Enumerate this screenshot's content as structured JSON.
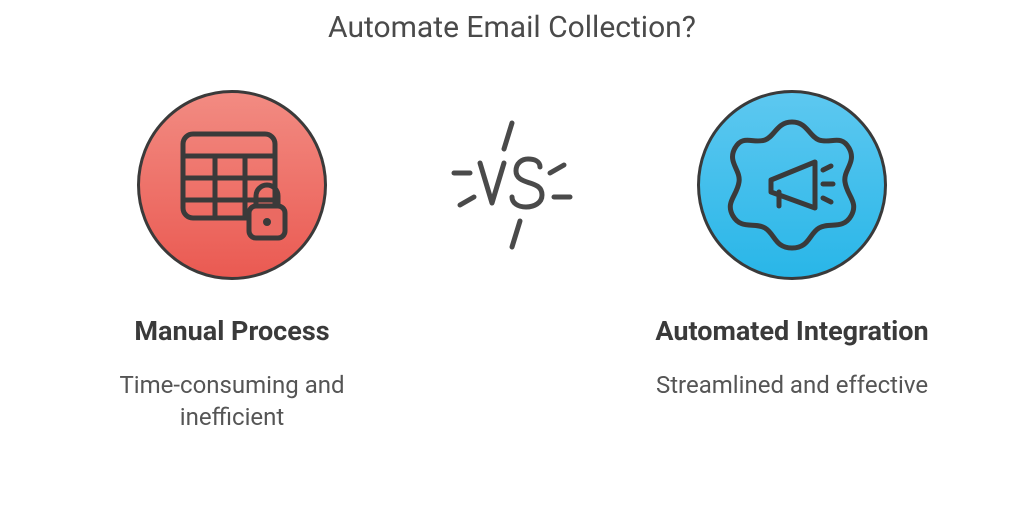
{
  "title": "Automate Email Collection?",
  "left": {
    "title": "Manual Process",
    "description": "Time-consuming and inefficient",
    "color": "#ea5a52",
    "icon": "spreadsheet-lock-icon"
  },
  "right": {
    "title": "Automated Integration",
    "description": "Streamlined and effective",
    "color": "#29b6e8",
    "icon": "gear-megaphone-icon"
  },
  "vs_label": "VS"
}
